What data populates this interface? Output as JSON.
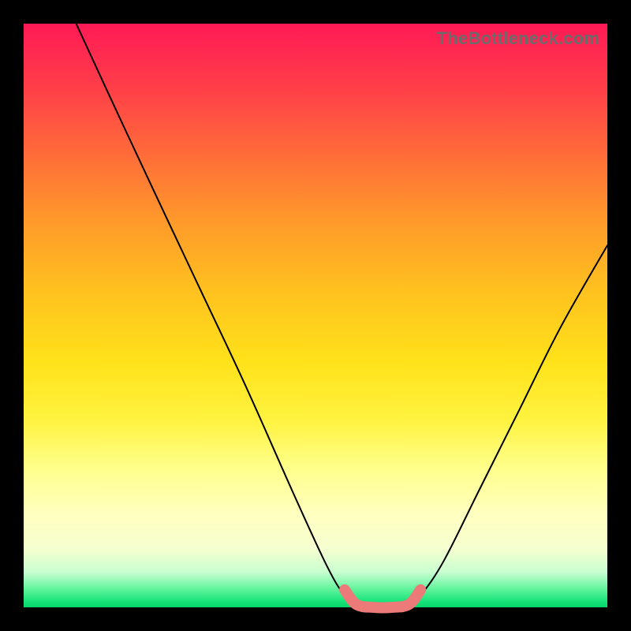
{
  "watermark": "TheBottleneck.com",
  "chart_data": {
    "type": "line",
    "title": "",
    "xlabel": "",
    "ylabel": "",
    "xlim": [
      0,
      100
    ],
    "ylim": [
      0,
      100
    ],
    "grid": false,
    "legend": false,
    "series": [
      {
        "name": "left-curve",
        "color": "#000000",
        "x": [
          9,
          15,
          22,
          30,
          38,
          46,
          52,
          55,
          57
        ],
        "values": [
          100,
          87,
          72,
          55,
          38,
          20,
          7,
          2,
          0
        ]
      },
      {
        "name": "right-curve",
        "color": "#000000",
        "x": [
          66,
          68,
          72,
          78,
          85,
          92,
          100
        ],
        "values": [
          0,
          2,
          8,
          20,
          34,
          48,
          62
        ]
      },
      {
        "name": "bottom-band",
        "color": "#ec7a78",
        "x": [
          55,
          57,
          60,
          63,
          66,
          68
        ],
        "values": [
          3,
          0.5,
          0,
          0,
          0.5,
          3
        ]
      }
    ]
  }
}
